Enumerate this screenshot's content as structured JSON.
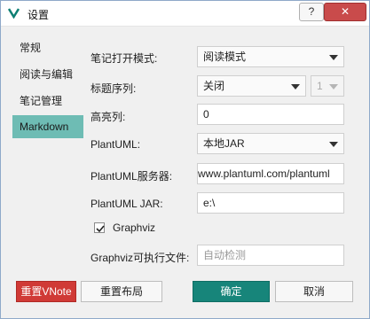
{
  "window": {
    "title": "设置",
    "help_label": "?",
    "close_label": "✕"
  },
  "sidebar": {
    "items": [
      {
        "label": "常规"
      },
      {
        "label": "阅读与编辑"
      },
      {
        "label": "笔记管理"
      },
      {
        "label": "Markdown",
        "active": true
      }
    ]
  },
  "form": {
    "open_mode": {
      "label": "笔记打开模式:",
      "value": "阅读模式"
    },
    "heading_sequence": {
      "label": "标题序列:",
      "value": "关闭",
      "level_value": "1"
    },
    "highlight_column": {
      "label": "高亮列:",
      "value": "0"
    },
    "plantuml": {
      "label": "PlantUML:",
      "value": "本地JAR"
    },
    "plantuml_server": {
      "label": "PlantUML服务器:",
      "value": "www.plantuml.com/plantuml"
    },
    "plantuml_jar": {
      "label": "PlantUML JAR:",
      "value": "e:\\"
    },
    "graphviz": {
      "label": "Graphviz",
      "checked": true
    },
    "graphviz_exe": {
      "label": "Graphviz可执行文件:",
      "placeholder": "自动检测"
    }
  },
  "buttons": {
    "reset_vnote": "重置VNote",
    "reset_layout": "重置布局",
    "ok": "确定",
    "cancel": "取消"
  },
  "colors": {
    "accent": "#17857a",
    "active_nav": "#6ebcb4",
    "danger": "#d03a36"
  },
  "icons": {
    "app": "vnote-logo-icon",
    "checkbox": "check-icon",
    "dropdown": "chevron-down-icon"
  }
}
